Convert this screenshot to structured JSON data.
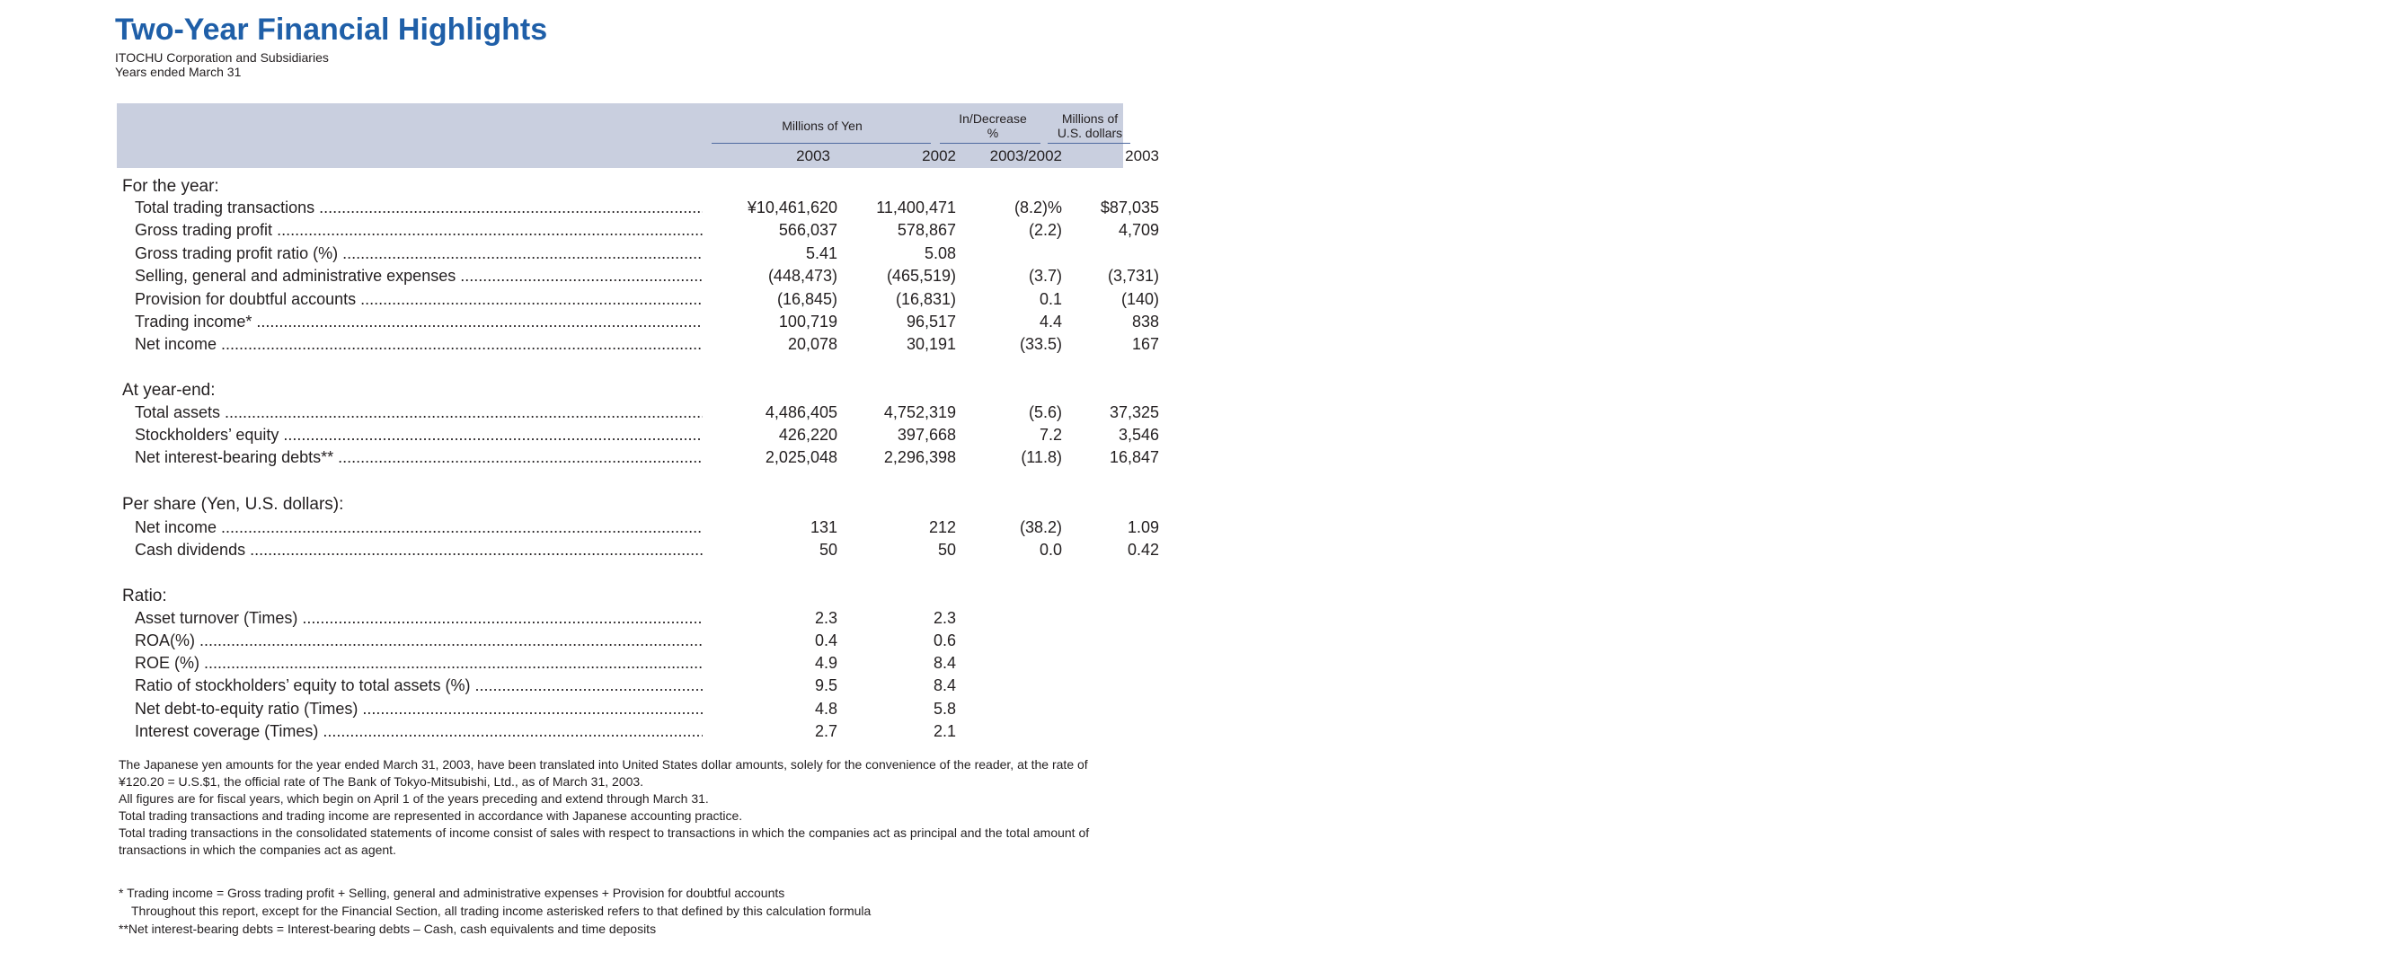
{
  "header": {
    "title": "Two-Year Financial Highlights",
    "company": "ITOCHU Corporation and Subsidiaries",
    "period": "Years ended March 31"
  },
  "columns": {
    "group_yen": "Millions of Yen",
    "group_change_1": "In/Decrease",
    "group_change_2": "%",
    "group_usd_1": "Millions of",
    "group_usd_2": "U.S. dollars",
    "y2003": "2003",
    "y2002": "2002",
    "change": "2003/2002",
    "usd_year": "2003"
  },
  "sections": {
    "for_the_year": "For the year:",
    "at_year_end": "At year-end:",
    "per_share": "Per share (Yen, U.S. dollars):",
    "ratio": "Ratio:"
  },
  "rows_year": [
    {
      "label": "Total trading transactions",
      "y2003": "¥10,461,620",
      "y2002": "11,400,471",
      "chg": "(8.2)%",
      "usd": "$87,035"
    },
    {
      "label": "Gross trading profit",
      "y2003": "566,037",
      "y2002": "578,867",
      "chg": "(2.2)",
      "usd": "4,709"
    },
    {
      "label": "Gross trading profit ratio (%)",
      "y2003": "5.41",
      "y2002": "5.08",
      "chg": "",
      "usd": ""
    },
    {
      "label": "Selling, general and administrative expenses",
      "y2003": "(448,473)",
      "y2002": "(465,519)",
      "chg": "(3.7)",
      "usd": "(3,731)"
    },
    {
      "label": "Provision for doubtful accounts",
      "y2003": "(16,845)",
      "y2002": "(16,831)",
      "chg": "0.1",
      "usd": "(140)"
    },
    {
      "label": "Trading income*",
      "y2003": "100,719",
      "y2002": "96,517",
      "chg": "4.4",
      "usd": "838"
    },
    {
      "label": "Net income",
      "y2003": "20,078",
      "y2002": "30,191",
      "chg": "(33.5)",
      "usd": "167"
    }
  ],
  "rows_end": [
    {
      "label": "Total assets",
      "y2003": "4,486,405",
      "y2002": "4,752,319",
      "chg": "(5.6)",
      "usd": "37,325"
    },
    {
      "label": "Stockholders’ equity",
      "y2003": "426,220",
      "y2002": "397,668",
      "chg": "7.2",
      "usd": "3,546"
    },
    {
      "label": "Net interest-bearing debts**",
      "y2003": "2,025,048",
      "y2002": "2,296,398",
      "chg": "(11.8)",
      "usd": "16,847"
    }
  ],
  "rows_share": [
    {
      "label": "Net income",
      "y2003": "131",
      "y2002": "212",
      "chg": "(38.2)",
      "usd": "1.09"
    },
    {
      "label": "Cash dividends",
      "y2003": "50",
      "y2002": "50",
      "chg": "0.0",
      "usd": "0.42"
    }
  ],
  "rows_ratio": [
    {
      "label": "Asset turnover (Times)",
      "y2003": "2.3",
      "y2002": "2.3"
    },
    {
      "label": "ROA(%)",
      "y2003": "0.4",
      "y2002": "0.6"
    },
    {
      "label": "ROE (%)",
      "y2003": "4.9",
      "y2002": "8.4"
    },
    {
      "label": "Ratio of stockholders’ equity to total assets (%)",
      "y2003": "9.5",
      "y2002": "8.4"
    },
    {
      "label": "Net debt-to-equity ratio (Times)",
      "y2003": "4.8",
      "y2002": "5.8"
    },
    {
      "label": "Interest coverage (Times)",
      "y2003": "2.7",
      "y2002": "2.1"
    }
  ],
  "notes": [
    "The Japanese yen amounts for the year ended March 31, 2003, have been translated into United States dollar amounts, solely for the convenience of the reader, at the rate of",
    "¥120.20 = U.S.$1, the official rate of The Bank of Tokyo-Mitsubishi, Ltd., as of March 31, 2003.",
    "All figures are for fiscal years, which begin on April 1 of the years preceding and extend through March 31.",
    "Total trading transactions and trading income are represented in accordance with Japanese accounting practice.",
    "Total trading transactions in the consolidated statements of income consist of sales with respect to transactions in which the companies act as principal and the total amount of",
    "transactions in which the companies act as agent."
  ],
  "defs": [
    "* Trading income = Gross trading profit + Selling, general and administrative expenses + Provision for doubtful accounts",
    "Throughout this report, except for the Financial Section, all trading income asterisked refers to that defined by this calculation formula",
    "**Net interest-bearing debts = Interest-bearing debts – Cash, cash equivalents and time deposits"
  ]
}
